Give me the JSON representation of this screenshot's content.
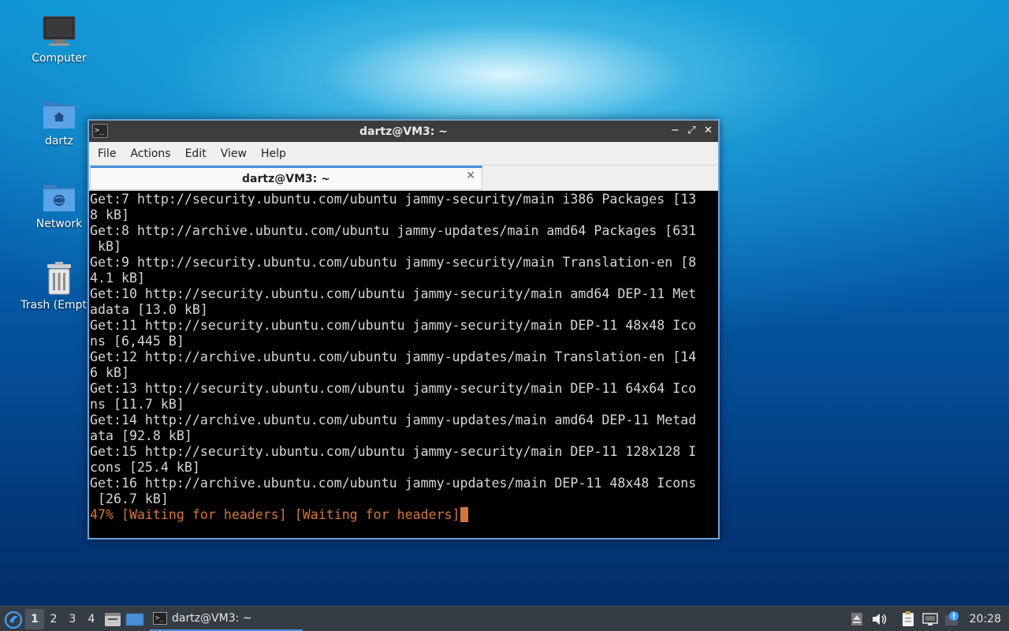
{
  "desktop": {
    "icons": [
      {
        "label": "Computer",
        "icon": "computer-icon"
      },
      {
        "label": "dartz",
        "icon": "home-folder-icon"
      },
      {
        "label": "Network",
        "icon": "network-folder-icon"
      },
      {
        "label": "Trash (Empty)",
        "icon": "trash-icon"
      }
    ]
  },
  "window": {
    "title": "dartz@VM3: ~",
    "app_icon": ">_",
    "controls": {
      "minimize": "−",
      "maximize": "⤢",
      "close": "✕"
    },
    "menu": [
      "File",
      "Actions",
      "Edit",
      "View",
      "Help"
    ],
    "tab": {
      "label": "dartz@VM3: ~",
      "close": "✕"
    },
    "terminal": {
      "lines": [
        "Get:7 http://security.ubuntu.com/ubuntu jammy-security/main i386 Packages [13",
        "8 kB]",
        "Get:8 http://archive.ubuntu.com/ubuntu jammy-updates/main amd64 Packages [631",
        " kB]",
        "Get:9 http://security.ubuntu.com/ubuntu jammy-security/main Translation-en [8",
        "4.1 kB]",
        "Get:10 http://security.ubuntu.com/ubuntu jammy-security/main amd64 DEP-11 Met",
        "adata [13.0 kB]",
        "Get:11 http://security.ubuntu.com/ubuntu jammy-security/main DEP-11 48x48 Ico",
        "ns [6,445 B]",
        "Get:12 http://archive.ubuntu.com/ubuntu jammy-updates/main Translation-en [14",
        "6 kB]",
        "Get:13 http://security.ubuntu.com/ubuntu jammy-security/main DEP-11 64x64 Ico",
        "ns [11.7 kB]",
        "Get:14 http://archive.ubuntu.com/ubuntu jammy-updates/main amd64 DEP-11 Metad",
        "ata [92.8 kB]",
        "Get:15 http://security.ubuntu.com/ubuntu jammy-security/main DEP-11 128x128 I",
        "cons [25.4 kB]",
        "Get:16 http://archive.ubuntu.com/ubuntu jammy-updates/main DEP-11 48x48 Icons",
        " [26.7 kB]"
      ],
      "progress_line": "47% [Waiting for headers] [Waiting for headers]",
      "progress_color": "#d4773a"
    }
  },
  "taskbar": {
    "start_icon": "lubuntu-logo-icon",
    "workspaces": [
      "1",
      "2",
      "3",
      "4"
    ],
    "active_workspace": "1",
    "launchers": [
      "file-manager-icon",
      "show-desktop-icon"
    ],
    "task": {
      "label": "dartz@VM3: ~",
      "icon": ">_"
    },
    "tray": [
      "eject-icon",
      "volume-icon",
      "clipboard-icon",
      "network-icon",
      "update-notifier-icon"
    ],
    "clock": "20:28"
  }
}
